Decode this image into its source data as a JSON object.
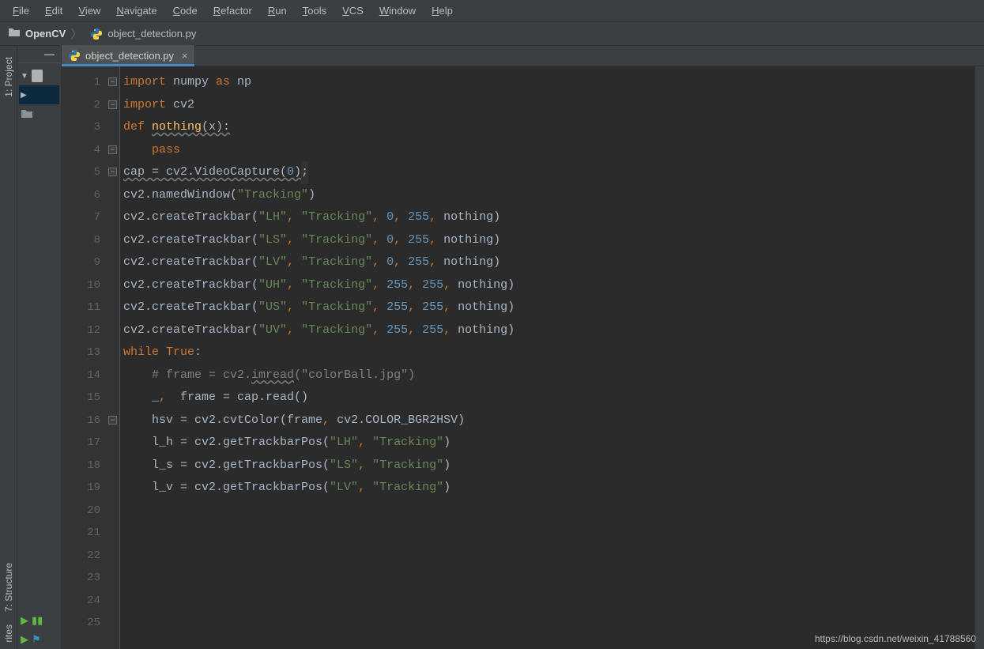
{
  "menu": [
    "File",
    "Edit",
    "View",
    "Navigate",
    "Code",
    "Refactor",
    "Run",
    "Tools",
    "VCS",
    "Window",
    "Help"
  ],
  "breadcrumb": {
    "project": "OpenCV",
    "file": "object_detection.py"
  },
  "tab": {
    "label": "object_detection.py"
  },
  "sideTabs": {
    "project": "1: Project",
    "structure": "7: Structure",
    "favorites": "rites"
  },
  "watermark": "https://blog.csdn.net/weixin_41788560",
  "code": {
    "lines": 25,
    "rows": [
      {
        "n": 1,
        "seg": [
          {
            "t": "import ",
            "c": "kw"
          },
          {
            "t": "numpy ",
            "c": ""
          },
          {
            "t": "as ",
            "c": "kw"
          },
          {
            "t": "np",
            "c": ""
          }
        ]
      },
      {
        "n": 2,
        "seg": [
          {
            "t": "import ",
            "c": "kw"
          },
          {
            "t": "cv2",
            "c": ""
          }
        ]
      },
      {
        "n": 3,
        "seg": [
          {
            "t": "",
            "c": ""
          }
        ]
      },
      {
        "n": 4,
        "seg": [
          {
            "t": "def ",
            "c": "kw"
          },
          {
            "t": "nothing",
            "c": "fn wavy"
          },
          {
            "t": "(x):",
            "c": "wavy"
          }
        ]
      },
      {
        "n": 5,
        "seg": [
          {
            "t": "    ",
            "c": ""
          },
          {
            "t": "pass",
            "c": "kw"
          }
        ]
      },
      {
        "n": 6,
        "seg": [
          {
            "t": "",
            "c": ""
          }
        ]
      },
      {
        "n": 7,
        "seg": [
          {
            "t": "cap = cv2.VideoCapture(",
            "c": "wavy"
          },
          {
            "t": "0",
            "c": "num wavy"
          },
          {
            "t": ")",
            "c": "wavy"
          },
          {
            "t": ";",
            "c": "caretbg"
          }
        ]
      },
      {
        "n": 8,
        "seg": [
          {
            "t": "cv2.namedWindow(",
            "c": ""
          },
          {
            "t": "\"Tracking\"",
            "c": "str"
          },
          {
            "t": ")",
            "c": ""
          }
        ]
      },
      {
        "n": 9,
        "seg": [
          {
            "t": "cv2.createTrackbar(",
            "c": ""
          },
          {
            "t": "\"LH\"",
            "c": "str"
          },
          {
            "t": ", ",
            "c": "punc"
          },
          {
            "t": "\"Tracking\"",
            "c": "str"
          },
          {
            "t": ", ",
            "c": "punc"
          },
          {
            "t": "0",
            "c": "num"
          },
          {
            "t": ", ",
            "c": "punc"
          },
          {
            "t": "255",
            "c": "num"
          },
          {
            "t": ", ",
            "c": "punc"
          },
          {
            "t": "nothing)",
            "c": ""
          }
        ]
      },
      {
        "n": 10,
        "seg": [
          {
            "t": "cv2.createTrackbar(",
            "c": ""
          },
          {
            "t": "\"LS\"",
            "c": "str"
          },
          {
            "t": ", ",
            "c": "punc"
          },
          {
            "t": "\"Tracking\"",
            "c": "str"
          },
          {
            "t": ", ",
            "c": "punc"
          },
          {
            "t": "0",
            "c": "num"
          },
          {
            "t": ", ",
            "c": "punc"
          },
          {
            "t": "255",
            "c": "num"
          },
          {
            "t": ", ",
            "c": "punc"
          },
          {
            "t": "nothing)",
            "c": ""
          }
        ]
      },
      {
        "n": 11,
        "seg": [
          {
            "t": "cv2.createTrackbar(",
            "c": ""
          },
          {
            "t": "\"LV\"",
            "c": "str"
          },
          {
            "t": ", ",
            "c": "punc"
          },
          {
            "t": "\"Tracking\"",
            "c": "str"
          },
          {
            "t": ", ",
            "c": "punc"
          },
          {
            "t": "0",
            "c": "num"
          },
          {
            "t": ", ",
            "c": "punc"
          },
          {
            "t": "255",
            "c": "num"
          },
          {
            "t": ", ",
            "c": "punc"
          },
          {
            "t": "nothing)",
            "c": ""
          }
        ]
      },
      {
        "n": 12,
        "seg": [
          {
            "t": "cv2.createTrackbar(",
            "c": ""
          },
          {
            "t": "\"UH\"",
            "c": "str"
          },
          {
            "t": ", ",
            "c": "punc"
          },
          {
            "t": "\"Tracking\"",
            "c": "str"
          },
          {
            "t": ", ",
            "c": "punc"
          },
          {
            "t": "255",
            "c": "num"
          },
          {
            "t": ", ",
            "c": "punc"
          },
          {
            "t": "255",
            "c": "num"
          },
          {
            "t": ", ",
            "c": "punc"
          },
          {
            "t": "nothing)",
            "c": ""
          }
        ]
      },
      {
        "n": 13,
        "seg": [
          {
            "t": "cv2.createTrackbar(",
            "c": ""
          },
          {
            "t": "\"US\"",
            "c": "str"
          },
          {
            "t": ", ",
            "c": "punc"
          },
          {
            "t": "\"Tracking\"",
            "c": "str"
          },
          {
            "t": ", ",
            "c": "punc"
          },
          {
            "t": "255",
            "c": "num"
          },
          {
            "t": ", ",
            "c": "punc"
          },
          {
            "t": "255",
            "c": "num"
          },
          {
            "t": ", ",
            "c": "punc"
          },
          {
            "t": "nothing)",
            "c": ""
          }
        ]
      },
      {
        "n": 14,
        "seg": [
          {
            "t": "cv2.createTrackbar(",
            "c": ""
          },
          {
            "t": "\"UV\"",
            "c": "str"
          },
          {
            "t": ", ",
            "c": "punc"
          },
          {
            "t": "\"Tracking\"",
            "c": "str"
          },
          {
            "t": ", ",
            "c": "punc"
          },
          {
            "t": "255",
            "c": "num"
          },
          {
            "t": ", ",
            "c": "punc"
          },
          {
            "t": "255",
            "c": "num"
          },
          {
            "t": ", ",
            "c": "punc"
          },
          {
            "t": "nothing)",
            "c": ""
          }
        ]
      },
      {
        "n": 15,
        "seg": [
          {
            "t": "",
            "c": ""
          }
        ]
      },
      {
        "n": 16,
        "seg": [
          {
            "t": "while ",
            "c": "kw"
          },
          {
            "t": "True",
            "c": "kw"
          },
          {
            "t": ":",
            "c": ""
          }
        ]
      },
      {
        "n": 17,
        "seg": [
          {
            "t": "    ",
            "c": ""
          },
          {
            "t": "# frame = cv2.",
            "c": "com"
          },
          {
            "t": "imread",
            "c": "com wavy"
          },
          {
            "t": "(\"colorBall.jpg\")",
            "c": "com"
          }
        ]
      },
      {
        "n": 18,
        "seg": [
          {
            "t": "    _",
            "c": ""
          },
          {
            "t": ",",
            "c": "punc"
          },
          {
            "t": "  frame = cap.read()",
            "c": ""
          }
        ]
      },
      {
        "n": 19,
        "seg": [
          {
            "t": "",
            "c": ""
          }
        ]
      },
      {
        "n": 20,
        "seg": [
          {
            "t": "    hsv = cv2.cvtColor(frame",
            "c": ""
          },
          {
            "t": ", ",
            "c": "punc"
          },
          {
            "t": "cv2.COLOR_BGR2HSV)",
            "c": ""
          }
        ]
      },
      {
        "n": 21,
        "seg": [
          {
            "t": "",
            "c": ""
          }
        ]
      },
      {
        "n": 22,
        "seg": [
          {
            "t": "    l_h = cv2.getTrackbarPos(",
            "c": ""
          },
          {
            "t": "\"LH\"",
            "c": "str"
          },
          {
            "t": ", ",
            "c": "punc"
          },
          {
            "t": "\"Tracking\"",
            "c": "str"
          },
          {
            "t": ")",
            "c": ""
          }
        ]
      },
      {
        "n": 23,
        "seg": [
          {
            "t": "    l_s = cv2.getTrackbarPos(",
            "c": ""
          },
          {
            "t": "\"LS\"",
            "c": "str"
          },
          {
            "t": ", ",
            "c": "punc"
          },
          {
            "t": "\"Tracking\"",
            "c": "str"
          },
          {
            "t": ")",
            "c": ""
          }
        ]
      },
      {
        "n": 24,
        "seg": [
          {
            "t": "    l_v = cv2.getTrackbarPos(",
            "c": ""
          },
          {
            "t": "\"LV\"",
            "c": "str"
          },
          {
            "t": ", ",
            "c": "punc"
          },
          {
            "t": "\"Tracking\"",
            "c": "str"
          },
          {
            "t": ")",
            "c": ""
          }
        ]
      },
      {
        "n": 25,
        "seg": [
          {
            "t": "",
            "c": ""
          }
        ]
      }
    ]
  }
}
